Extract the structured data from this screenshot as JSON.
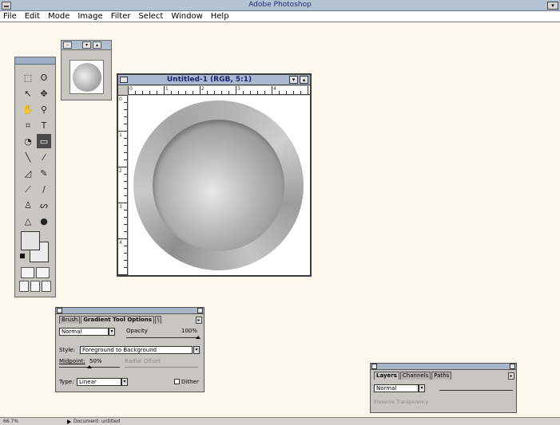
{
  "app": {
    "title": "Adobe Photoshop"
  },
  "menu": [
    "File",
    "Edit",
    "Mode",
    "Image",
    "Filter",
    "Select",
    "Window",
    "Help"
  ],
  "document": {
    "title": "Untitled-1  (RGB, 5:1)",
    "ruler_h": [
      "0",
      "1",
      "2",
      "3",
      "4"
    ],
    "ruler_v": [
      "0",
      "1",
      "2",
      "3",
      "4"
    ]
  },
  "tools": {
    "items": [
      {
        "name": "marquee-tool-icon",
        "glyph": "⬚"
      },
      {
        "name": "lasso-tool-icon",
        "glyph": "ʘ"
      },
      {
        "name": "crop-arrow-tool-icon",
        "glyph": "↖"
      },
      {
        "name": "move-tool-icon",
        "glyph": "✥"
      },
      {
        "name": "hand-tool-icon",
        "glyph": "✋"
      },
      {
        "name": "zoom-tool-icon",
        "glyph": "⚲"
      },
      {
        "name": "crop-tool-icon",
        "glyph": "⌗"
      },
      {
        "name": "type-tool-icon",
        "glyph": "T"
      },
      {
        "name": "paint-bucket-tool-icon",
        "glyph": "◔"
      },
      {
        "name": "gradient-tool-icon",
        "glyph": "▭"
      },
      {
        "name": "line-tool-icon",
        "glyph": "╲"
      },
      {
        "name": "eyedropper-tool-icon",
        "glyph": "⁄"
      },
      {
        "name": "eraser-tool-icon",
        "glyph": "◿"
      },
      {
        "name": "pencil-tool-icon",
        "glyph": "✎"
      },
      {
        "name": "airbrush-tool-icon",
        "glyph": "⟋"
      },
      {
        "name": "brush-tool-icon",
        "glyph": "∕"
      },
      {
        "name": "stamp-tool-icon",
        "glyph": "♙"
      },
      {
        "name": "smudge-tool-icon",
        "glyph": "ᔕ"
      },
      {
        "name": "blur-tool-icon",
        "glyph": "△"
      },
      {
        "name": "dodge-tool-icon",
        "glyph": "●"
      }
    ],
    "active_index": 9
  },
  "gradient_options": {
    "tabs": [
      "Brush",
      "Gradient Tool Options",
      "\\"
    ],
    "mode": "Normal",
    "opacity_label": "Opacity",
    "opacity_value": "100%",
    "opacity_level": 1.0,
    "style_label": "Style:",
    "style_value": "Foreground to Background",
    "midpoint_label": "Midpoint:",
    "midpoint_value": "50%",
    "midpoint_level": 0.5,
    "radial_offset_label": "Radial Offset",
    "type_label": "Type:",
    "type_value": "Linear",
    "dither_label": "Dither"
  },
  "layers_palette": {
    "tabs": [
      "Layers",
      "Channels",
      "Paths"
    ],
    "mode": "Normal",
    "preserve": "Preserve Transparency"
  },
  "status": {
    "zoom": "66.7%",
    "message": "Document: untitled"
  }
}
